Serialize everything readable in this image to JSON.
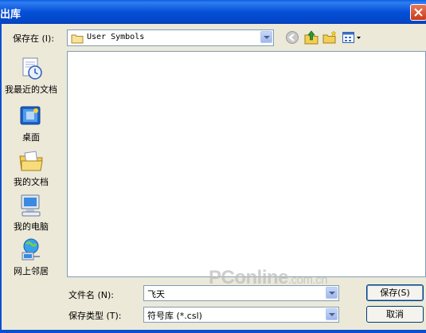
{
  "window": {
    "title": "出库"
  },
  "toolbar": {
    "save_in_label": "保存在 (I):",
    "save_in_value": "User Symbols"
  },
  "places": [
    {
      "label": "我最近的文档",
      "icon": "recent-documents-icon"
    },
    {
      "label": "桌面",
      "icon": "desktop-icon"
    },
    {
      "label": "我的文档",
      "icon": "my-documents-icon"
    },
    {
      "label": "我的电脑",
      "icon": "my-computer-icon"
    },
    {
      "label": "网上邻居",
      "icon": "network-places-icon"
    }
  ],
  "form": {
    "filename_label": "文件名 (N):",
    "filename_value": "飞天",
    "filetype_label": "保存类型 (T):",
    "filetype_value": "符号库 (*.csl)"
  },
  "buttons": {
    "save": "保存(S)",
    "cancel": "取消"
  },
  "watermark": {
    "main": "PConline",
    "suffix": ".com.cn"
  },
  "colors": {
    "titlebar": "#0550d8",
    "dialog_bg": "#ece9d8",
    "border": "#7f9db9"
  }
}
